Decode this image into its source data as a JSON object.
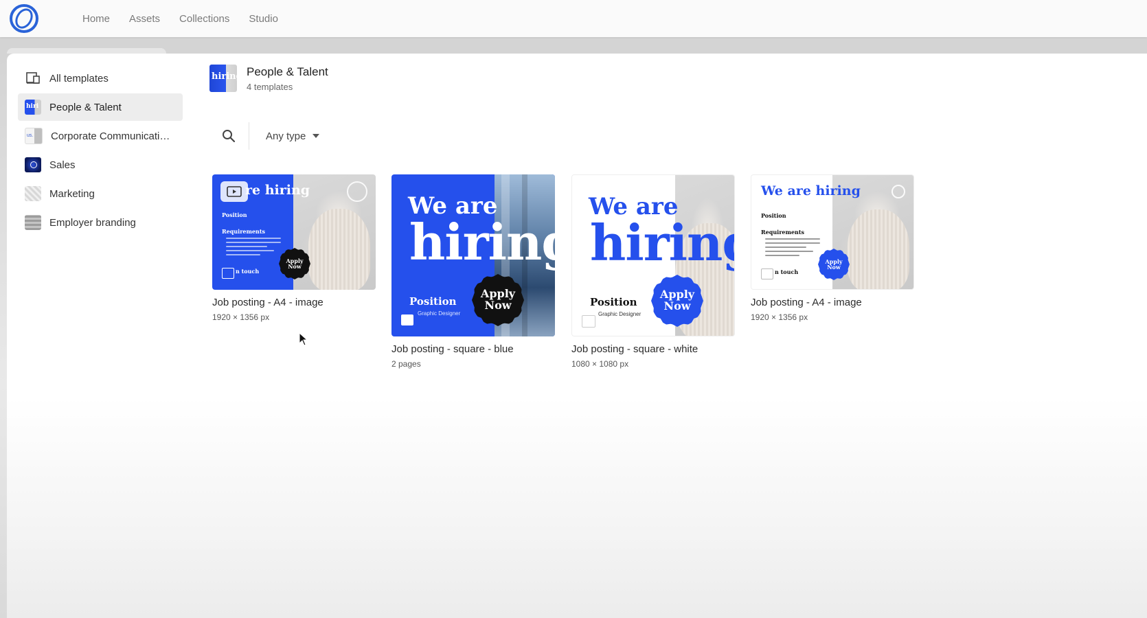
{
  "nav": {
    "items": [
      "Home",
      "Assets",
      "Collections",
      "Studio"
    ]
  },
  "sidebar": {
    "items": [
      {
        "label": "All templates",
        "icon": "templates-icon"
      },
      {
        "label": "People & Talent",
        "icon": "people-talent-thumb",
        "active": true
      },
      {
        "label": "Corporate Communicati…",
        "icon": "corporate-thumb"
      },
      {
        "label": "Sales",
        "icon": "sales-thumb"
      },
      {
        "label": "Marketing",
        "icon": "marketing-thumb"
      },
      {
        "label": "Employer branding",
        "icon": "employer-branding-thumb"
      }
    ]
  },
  "header": {
    "title": "People & Talent",
    "subtitle": "4 templates",
    "thumb_text": "hiring"
  },
  "toolbar": {
    "type_filter": "Any type"
  },
  "cards": [
    {
      "title": "Job posting - A4 - image",
      "meta": "1920 × 1356 px",
      "thumb": {
        "headline": "re hiring",
        "position": "Position",
        "requirements": "Requirements",
        "apply": "Apply Now",
        "touch": "n touch"
      }
    },
    {
      "title": "Job posting - square - blue",
      "meta": "2 pages",
      "thumb": {
        "line1": "We are",
        "line2": "hiring",
        "position": "Position",
        "role": "Graphic Designer",
        "apply1": "Apply",
        "apply2": "Now"
      }
    },
    {
      "title": "Job posting - square - white",
      "meta": "1080 × 1080 px",
      "thumb": {
        "line1": "We are",
        "line2": "hiring",
        "position": "Position",
        "role": "Graphic Designer",
        "apply1": "Apply",
        "apply2": "Now"
      }
    },
    {
      "title": "Job posting - A4 - image",
      "meta": "1920 × 1356 px",
      "thumb": {
        "headline": "We are hiring",
        "position": "Position",
        "requirements": "Requirements",
        "apply": "Apply Now",
        "touch": "n touch"
      }
    }
  ],
  "colors": {
    "brand_blue": "#2550ec",
    "logo_blue": "#2a63d8",
    "badge_dark": "#111111"
  }
}
